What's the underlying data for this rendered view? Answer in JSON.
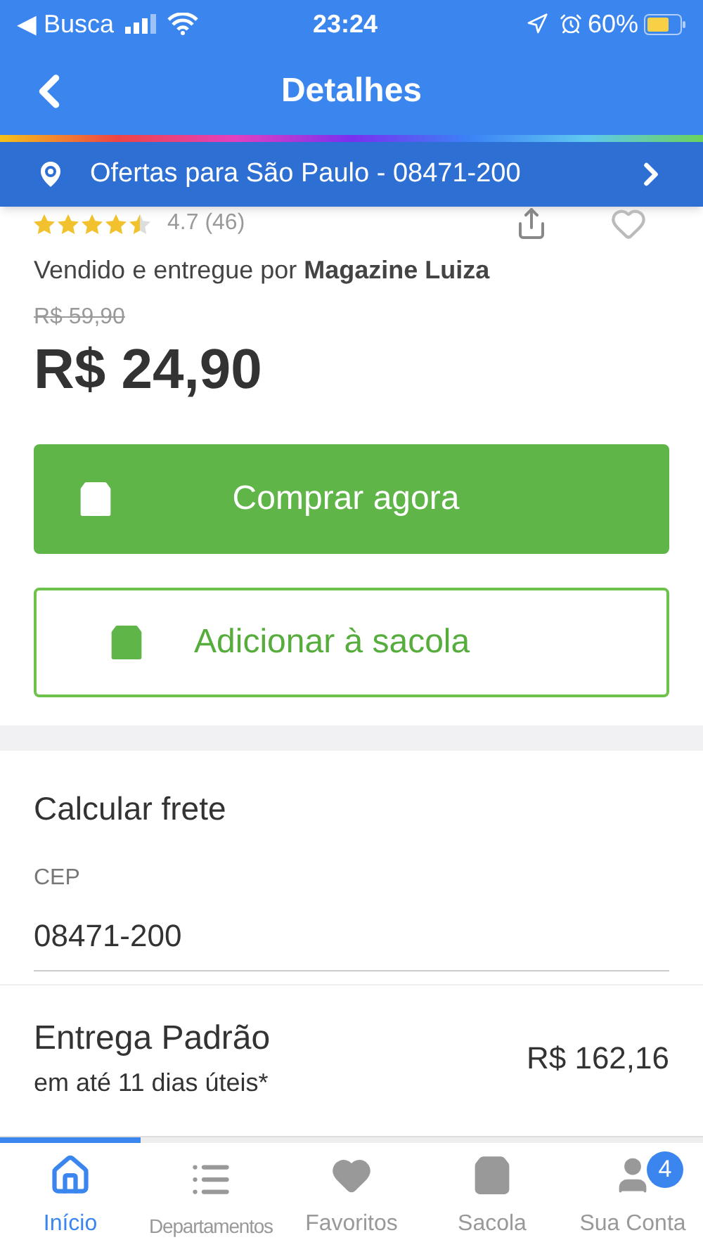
{
  "status_bar": {
    "back_app": "◀ Busca",
    "time": "23:24",
    "battery": "60%"
  },
  "header": {
    "title": "Detalhes"
  },
  "location_bar": {
    "text": "Ofertas para São Paulo - 08471-200"
  },
  "product": {
    "stars": 4.5,
    "rating": "4.7 (46)",
    "favorite": false,
    "seller": "Vendido e entregue por **Magazine Luiza**",
    "old_price": "R$ 59,90",
    "price": "R$ 24,90"
  },
  "buttons": [
    {
      "kind": "primary",
      "label": "Comprar agora"
    },
    {
      "kind": "outline",
      "label": "Adicionar à sacola"
    }
  ],
  "shipping": {
    "title": "Calcular frete",
    "cep_label": "CEP",
    "cep_value": "08471-200",
    "option": {
      "name": "Entrega Padrão",
      "time": "em até 11 dias úteis*",
      "price": "R$ 162,16"
    }
  },
  "tab_bar": {
    "progress": {
      "level": 0.2
    },
    "tabs": [
      {
        "kind": "home",
        "label": "Início",
        "selected": true
      },
      {
        "kind": "list",
        "label": "Departamentos",
        "selected": false
      },
      {
        "kind": "heart",
        "label": "Favoritos",
        "selected": false
      },
      {
        "kind": "bag",
        "label": "Sacola",
        "selected": false
      },
      {
        "kind": "user",
        "label": "Sua Conta",
        "selected": false,
        "badge": "4"
      }
    ]
  }
}
